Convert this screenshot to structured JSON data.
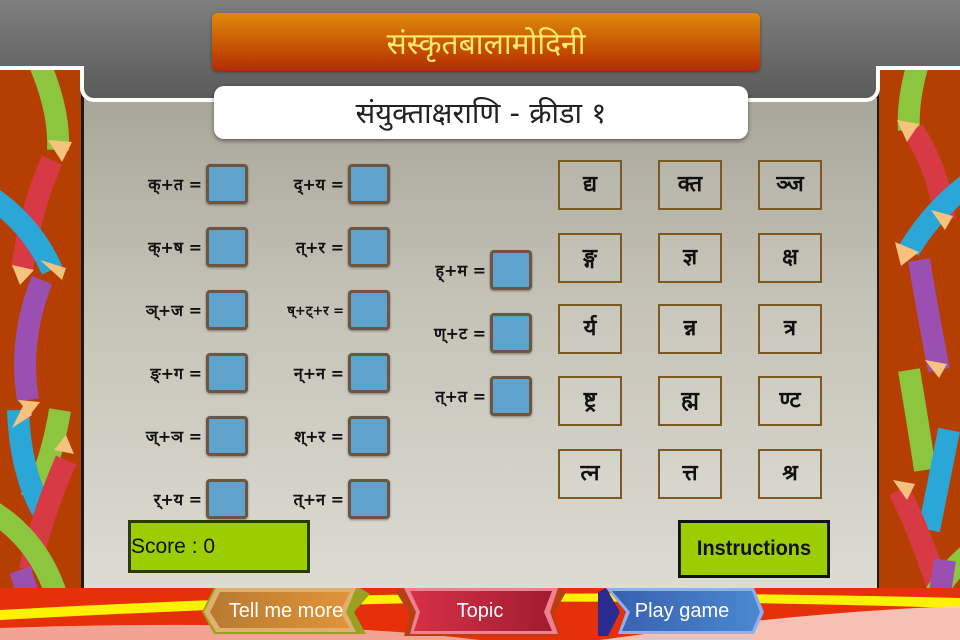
{
  "app": {
    "title": "संस्कृतबालामोदिनी",
    "subtitle": "संयुक्ताक्षराणि - क्रीडा १"
  },
  "equations": {
    "col1": [
      {
        "label": "क्+त ="
      },
      {
        "label": "क्+ष ="
      },
      {
        "label": "ञ्+ज ="
      },
      {
        "label": "ङ्+ग ="
      },
      {
        "label": "ज्+ञ ="
      },
      {
        "label": "र्+य ="
      }
    ],
    "col2": [
      {
        "label": "द्+य ="
      },
      {
        "label": "त्+र ="
      },
      {
        "label": "ष्+ट्+र ="
      },
      {
        "label": "न्+न ="
      },
      {
        "label": "श्+र ="
      },
      {
        "label": "त्+न ="
      }
    ],
    "col3": [
      {
        "label": "ह्+म ="
      },
      {
        "label": "ण्+ट ="
      },
      {
        "label": "त्+त ="
      }
    ]
  },
  "tiles": [
    [
      "द्य",
      "क्त",
      "ञ्ज"
    ],
    [
      "ङ्ग",
      "ज्ञ",
      "क्ष"
    ],
    [
      "र्य",
      "न्न",
      "त्र"
    ],
    [
      "ष्ट्र",
      "ह्म",
      "ण्ट"
    ],
    [
      "त्न",
      "त्त",
      "श्र"
    ]
  ],
  "score": {
    "label": "Score : 0"
  },
  "buttons": {
    "instructions": "Instructions",
    "tell_me_more": "Tell me more",
    "topic": "Topic",
    "play_game": "Play game"
  },
  "colors": {
    "side_panel": "#b53f02",
    "drop_box": "#5fa3cc",
    "score_bg": "#9bcd01",
    "title_top": "#e08a08",
    "title_bottom": "#b32c02",
    "title_text": "#ffe96a"
  }
}
